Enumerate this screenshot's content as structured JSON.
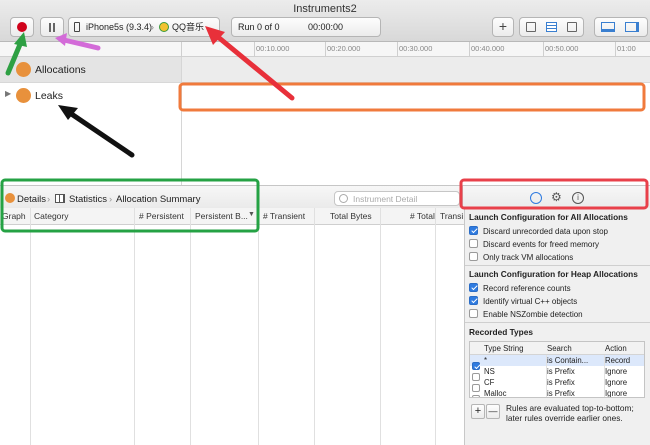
{
  "window": {
    "title": "Instruments2"
  },
  "toolbar": {
    "device": "iPhone5s (9.3.4)",
    "app": "QQ音乐",
    "run": "Run 0 of 0",
    "time": "00:00:00",
    "add_label": "+"
  },
  "ruler": {
    "ticks": [
      "00:10.000",
      "00:20.000",
      "00:30.000",
      "00:40.000",
      "00:50.000",
      "01:00"
    ]
  },
  "tracks": [
    {
      "label": "Allocations"
    },
    {
      "label": "Leaks"
    }
  ],
  "navbar": {
    "crumbs": [
      "Details",
      "Statistics",
      "Allocation Summary"
    ],
    "search_placeholder": "Instrument Detail"
  },
  "table": {
    "headers": [
      "Graph",
      "Category",
      "# Persistent",
      "Persistent B...",
      "# Transient",
      "Total Bytes",
      "# Total",
      "Transi"
    ]
  },
  "inspector": {
    "sec1": {
      "title": "Launch Configuration for All Allocations",
      "options": [
        {
          "label": "Discard unrecorded data upon stop",
          "checked": true
        },
        {
          "label": "Discard events for freed memory",
          "checked": false
        },
        {
          "label": "Only track VM allocations",
          "checked": false
        }
      ]
    },
    "sec2": {
      "title": "Launch Configuration for Heap Allocations",
      "options": [
        {
          "label": "Record reference counts",
          "checked": true
        },
        {
          "label": "Identify virtual C++ objects",
          "checked": true
        },
        {
          "label": "Enable NSZombie detection",
          "checked": false
        }
      ]
    },
    "recorded": {
      "title": "Recorded Types",
      "headers": [
        "Type String",
        "Search",
        "Action"
      ],
      "rows": [
        {
          "checked": true,
          "type": "*",
          "search": "is Contain...",
          "action": "Record"
        },
        {
          "checked": false,
          "type": "NS",
          "search": "is Prefix",
          "action": "Ignore"
        },
        {
          "checked": false,
          "type": "CF",
          "search": "is Prefix",
          "action": "Ignore"
        },
        {
          "checked": false,
          "type": "Malloc",
          "search": "is Prefix",
          "action": "Ignore"
        }
      ],
      "add": "+",
      "remove": "—",
      "note": "Rules are evaluated top-to-bottom; later rules override earlier ones."
    }
  },
  "annotation_colors": {
    "green": "#2ea043",
    "magenta": "#d36bd8",
    "red": "#e8303a",
    "orange": "#f07a3c",
    "black": "#111111",
    "green_box": "#25a244",
    "red_box": "#e8404a"
  }
}
